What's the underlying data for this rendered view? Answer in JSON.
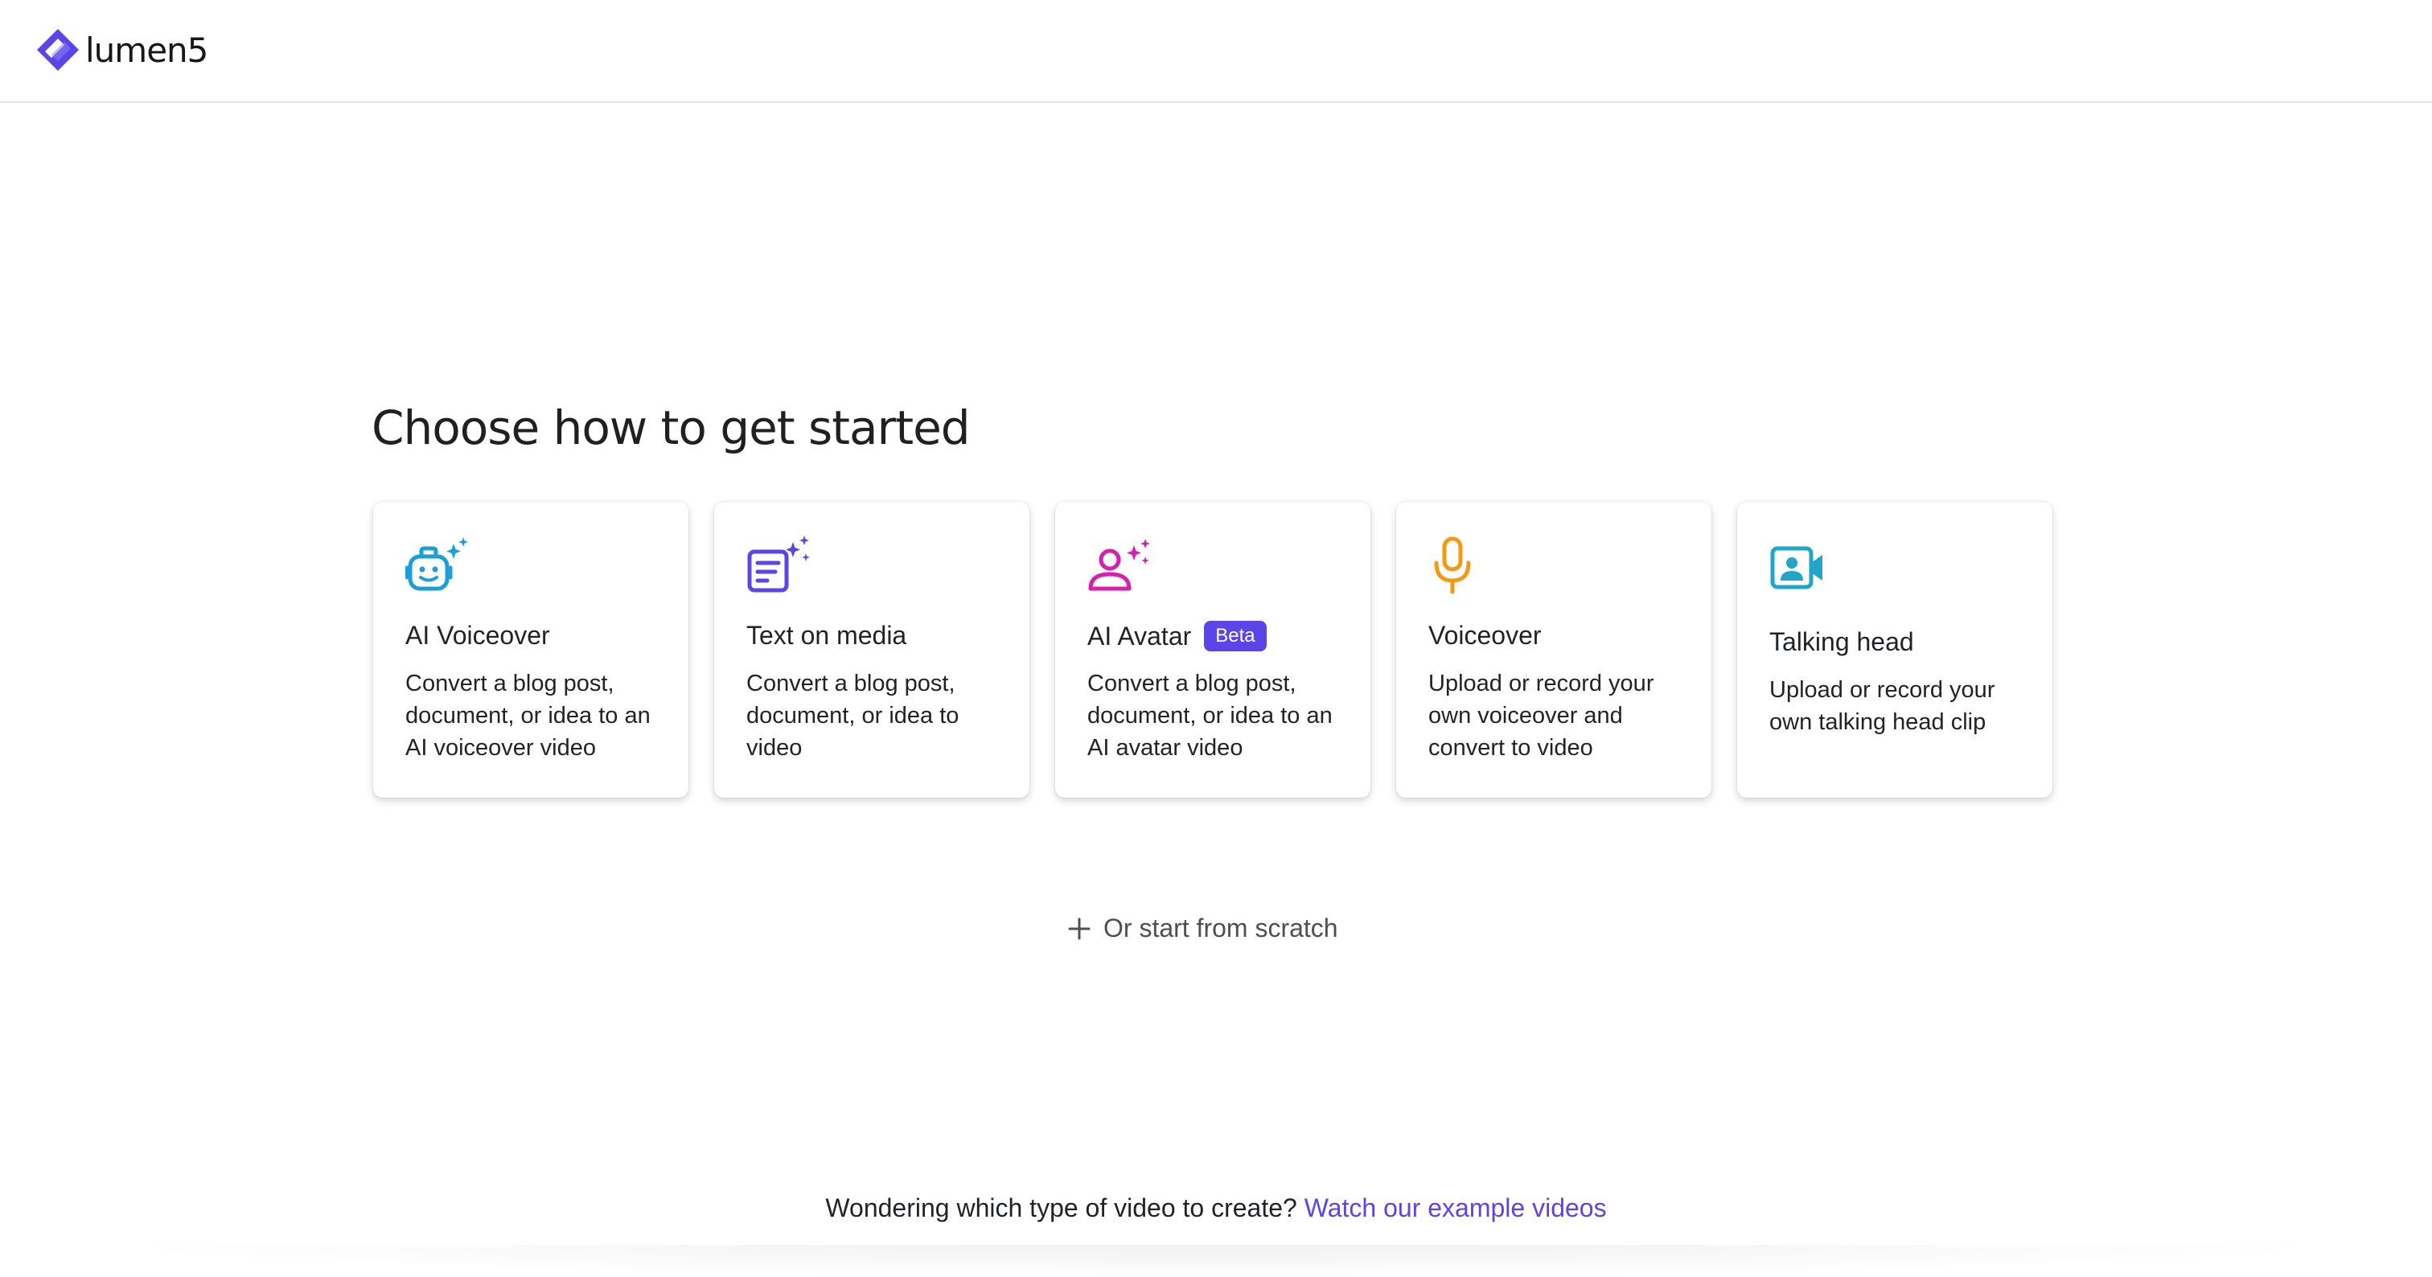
{
  "brand": {
    "name": "lumen5",
    "accent": "#5b45e8",
    "logo_icon": "lumen5-logo-icon"
  },
  "main": {
    "heading": "Choose how to get started",
    "cards": [
      {
        "title": "AI Voiceover",
        "description": "Convert a blog post, document, or idea to an AI voiceover video",
        "icon": "ai-robot-sparkle-icon",
        "icon_color": "#1b9fd6"
      },
      {
        "title": "Text on media",
        "description": "Convert a blog post, document, or idea to video",
        "icon": "text-document-sparkle-icon",
        "icon_color": "#5b45e8"
      },
      {
        "title": "AI Avatar",
        "badge": "Beta",
        "description": "Convert a blog post, document, or idea to an AI avatar video",
        "icon": "avatar-sparkle-icon",
        "icon_color": "#d61fb1"
      },
      {
        "title": "Voiceover",
        "description": "Upload or record your own voiceover and convert to video",
        "icon": "microphone-icon",
        "icon_color": "#f29a14"
      },
      {
        "title": "Talking head",
        "description": "Upload or record your own talking head clip",
        "icon": "video-camera-person-icon",
        "icon_color": "#1fa6c9"
      }
    ],
    "scratch_label": "Or start from scratch"
  },
  "footer": {
    "question": "Wondering which type of video to create?",
    "link_label": "Watch our example videos"
  }
}
